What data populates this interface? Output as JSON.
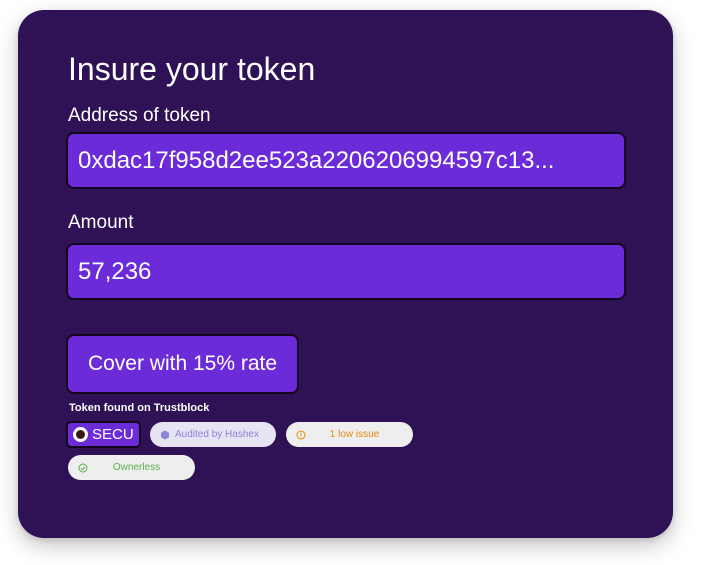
{
  "form": {
    "title": "Insure your token",
    "address_label": "Address of token",
    "address_value": "0xdac17f958d2ee523a2206206994597c13...",
    "amount_label": "Amount",
    "amount_value": "57,236",
    "cover_button_label": "Cover with 15% rate"
  },
  "trustblock": {
    "found_text": "Token found on Trustblock",
    "token_symbol": "SECU",
    "token_icon": "token-logo-icon",
    "badges": [
      {
        "label": "Audited by Hashex",
        "icon": "hexagon-icon",
        "color": "#8a85d6"
      },
      {
        "label": "1 low issue",
        "icon": "warning-circle-icon",
        "color": "#e48a12"
      },
      {
        "label": "Ownerless",
        "icon": "check-circle-icon",
        "color": "#58b24a"
      }
    ]
  },
  "colors": {
    "card_background": "#2f1156",
    "accent": "#6c2bd9",
    "border": "#14061f"
  }
}
